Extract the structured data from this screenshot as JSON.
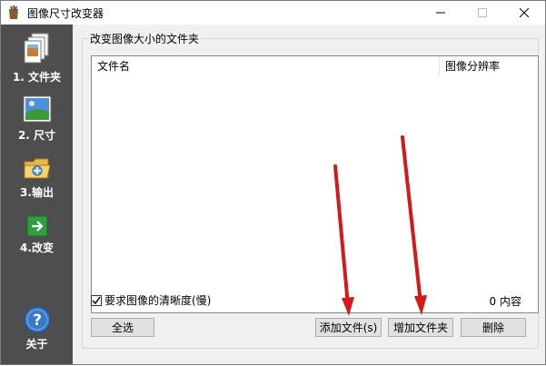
{
  "window": {
    "title": "图像尺寸改变器"
  },
  "sidebar": {
    "items": [
      {
        "label": "1. 文件夹",
        "icon": "files-icon"
      },
      {
        "label": "2. 尺寸",
        "icon": "landscape-image-icon"
      },
      {
        "label": "3.输出",
        "icon": "output-folder-icon"
      },
      {
        "label": "4.改变",
        "icon": "green-arrow-icon"
      },
      {
        "label": "关于",
        "icon": "help-icon"
      }
    ]
  },
  "main": {
    "group_title": "改变图像大小的文件夹",
    "columns": [
      "文件名",
      "图像分辨率"
    ],
    "files": [],
    "quality_checkbox": {
      "label": "要求图像的清晰度(慢)",
      "checked": true
    },
    "count_text": "0 内容",
    "buttons": {
      "select_all": "全选",
      "add_file": "添加文件(s)",
      "add_folder": "增加文件夹",
      "delete": "删除"
    }
  },
  "colors": {
    "sidebar": "#4e4e4e",
    "annotation_arrow": "#d21a1a",
    "window_bg": "#f0f0f0"
  }
}
